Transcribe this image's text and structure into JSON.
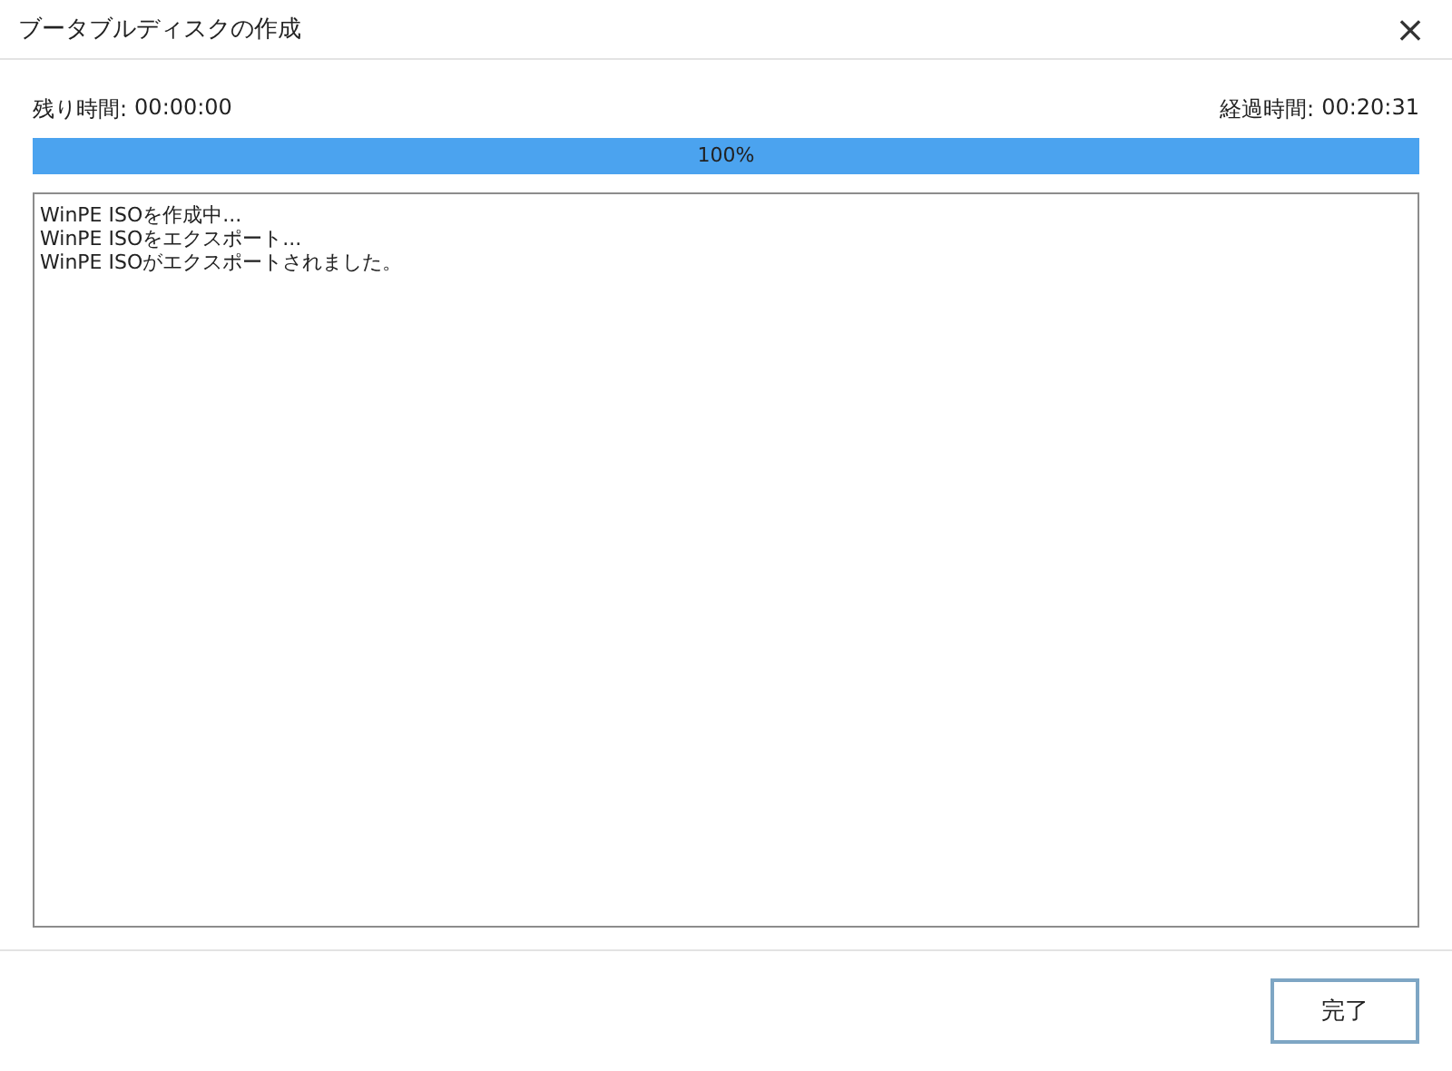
{
  "window": {
    "title": "ブータブルディスクの作成",
    "close": "×"
  },
  "remaining": {
    "label": "残り時間:",
    "value": "00:00:00"
  },
  "elapsed": {
    "label": "経過時間:",
    "value": "00:20:31"
  },
  "progress": {
    "level": 1,
    "reading": "100%"
  },
  "log": [
    "WinPE ISOを作成中...",
    "WinPE ISOをエクスポート...",
    "WinPE ISOがエクスポートされました。"
  ],
  "buttons": [
    {
      "label": "完了"
    }
  ]
}
